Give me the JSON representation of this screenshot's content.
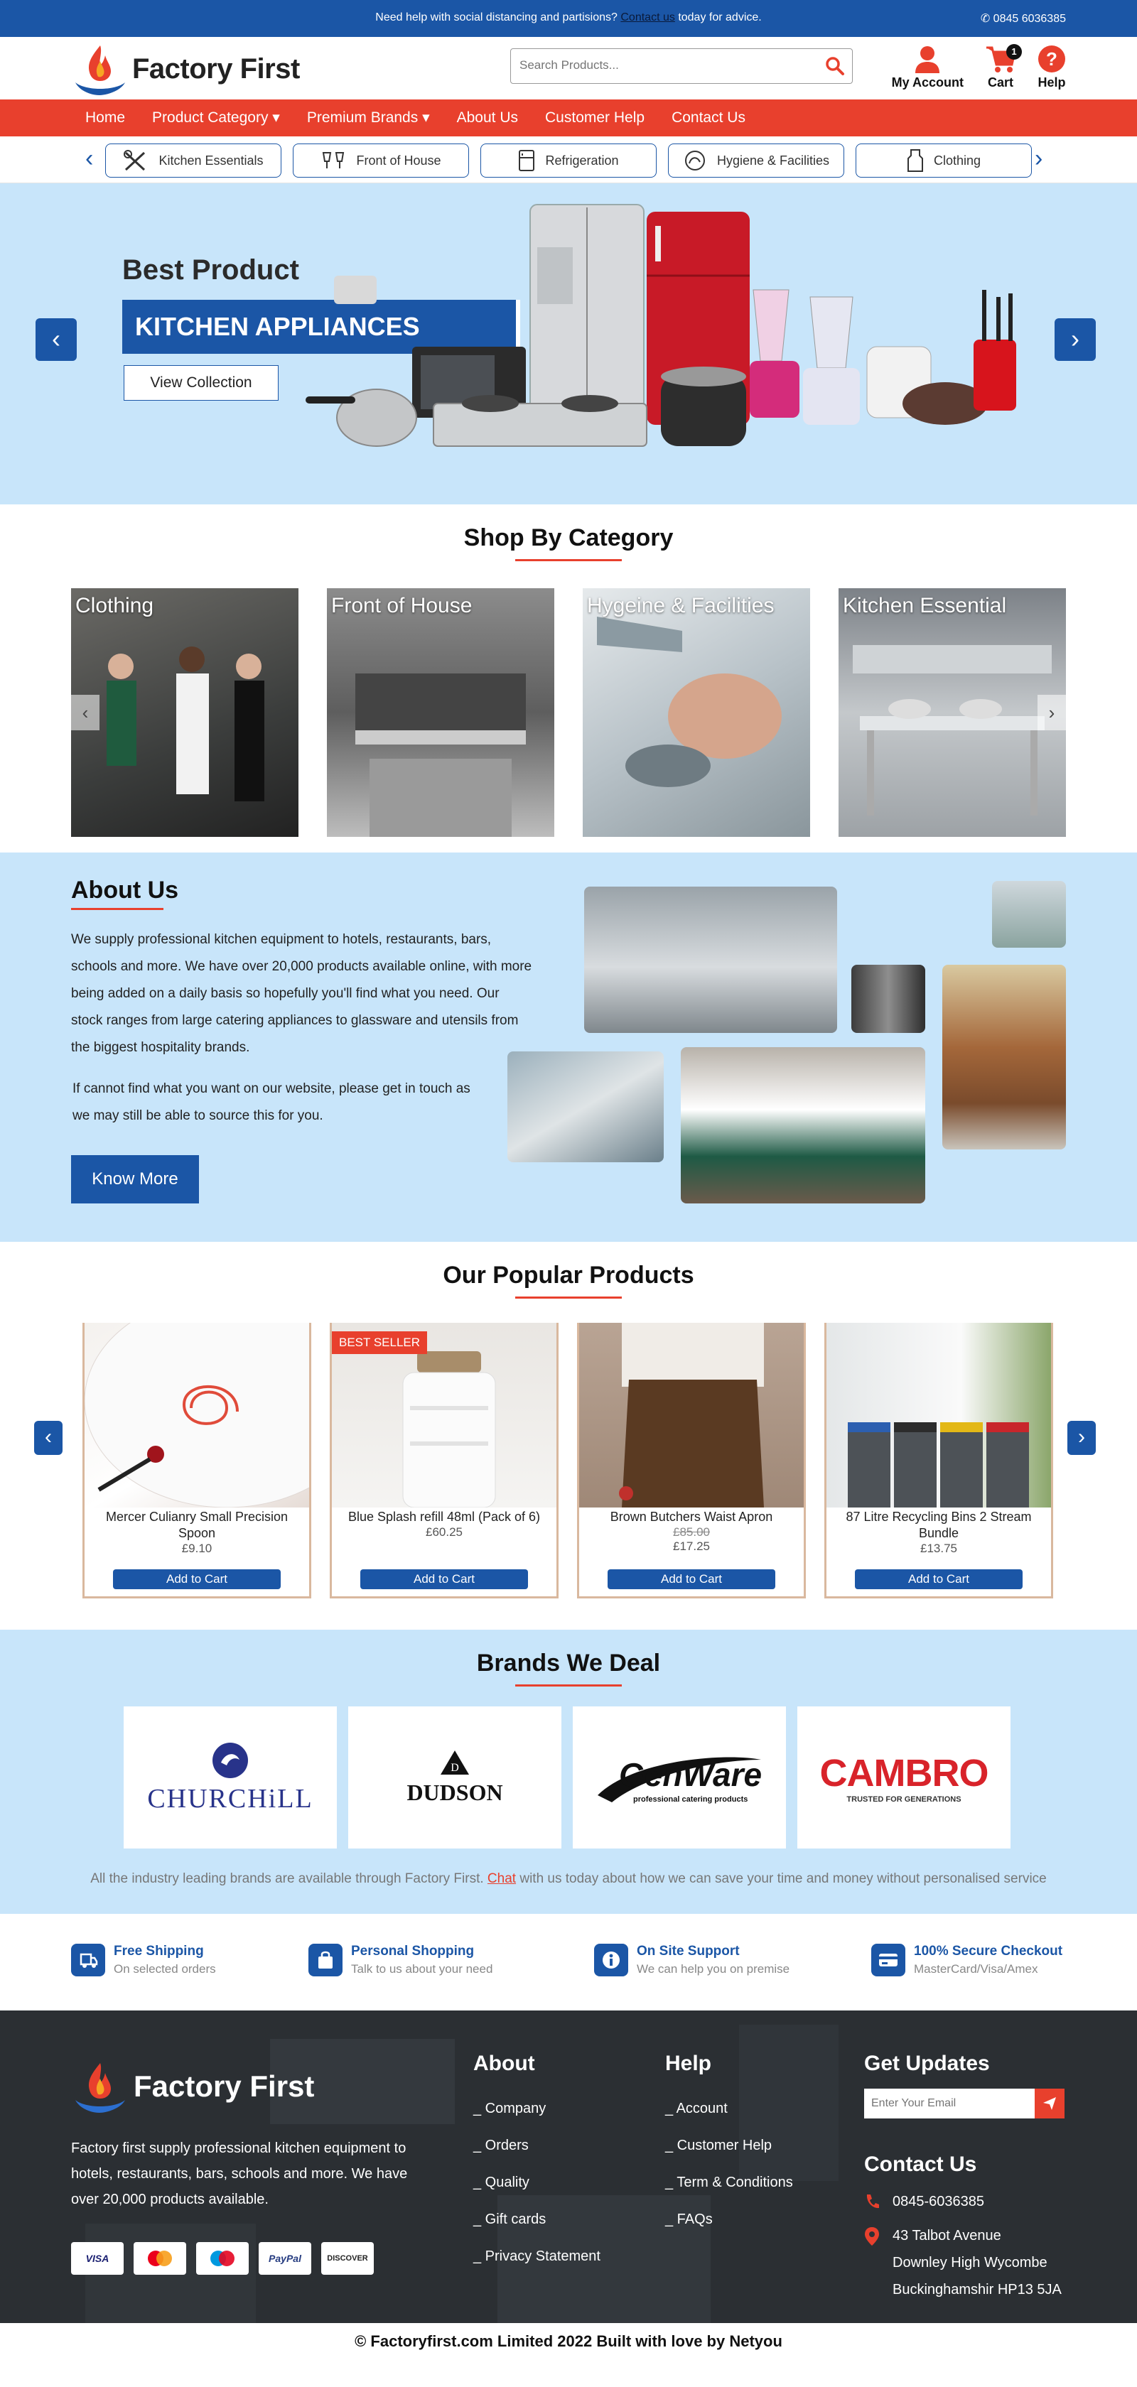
{
  "topbar": {
    "message_before": "Need help with social distancing and  partisions?",
    "message_link": "Contact us",
    "message_after": "today for advice.",
    "phone": "0845 6036385"
  },
  "header": {
    "logo_text": "Factory First",
    "search_placeholder": "Search Products...",
    "account_label": "My Account",
    "cart_label": "Cart",
    "cart_count": "1",
    "help_label": "Help"
  },
  "nav": {
    "items": [
      "Home",
      "Product Category",
      "Premium Brands",
      "About Us",
      "Customer Help",
      "Contact Us"
    ]
  },
  "category_pills": [
    "Kitchen Essentials",
    "Front of House",
    "Refrigeration",
    "Hygiene & Facilities",
    "Clothing"
  ],
  "hero": {
    "subtitle": "Best Product",
    "title": "KITCHEN APPLIANCES",
    "button": "View Collection"
  },
  "shop_by_category": {
    "title": "Shop By Category",
    "items": [
      "Clothing",
      "Front of House",
      "Hygeine & Facilities",
      "Kitchen Essential"
    ]
  },
  "about": {
    "title": "About Us",
    "p1": "We supply professional kitchen equipment to hotels, restaurants, bars, schools and more. We have over 20,000 products available online, with more being added on a daily basis so hopefully you'll find what you need. Our stock ranges from large catering appliances  to glassware and utensils from the biggest hospitality brands.",
    "p2": "If cannot find what you want on our website, please get in touch as we may still be able to source this for you.",
    "button": "Know More"
  },
  "popular": {
    "title": "Our Popular Products",
    "products": [
      {
        "name": "Mercer Culianry Small Precision Spoon",
        "price": "£9.10",
        "old_price": "",
        "badge": "",
        "cta": "Add to Cart"
      },
      {
        "name": "Blue Splash refill 48ml (Pack of 6)",
        "price": "£60.25",
        "old_price": "",
        "badge": "BEST SELLER",
        "cta": "Add to Cart"
      },
      {
        "name": "Brown Butchers Waist Apron",
        "price": "£17.25",
        "old_price": "£85.00",
        "badge": "",
        "cta": "Add to Cart"
      },
      {
        "name": "87 Litre Recycling Bins 2 Stream Bundle",
        "price": "£13.75",
        "old_price": "",
        "badge": "",
        "cta": "Add to Cart"
      }
    ]
  },
  "brands": {
    "title": "Brands We Deal",
    "items": [
      "CHURCHiLL",
      "DUDSON",
      "GenWare",
      "CAMBRO"
    ],
    "genware_tag": "professional catering products",
    "cambro_tag": "TRUSTED FOR GENERATIONS",
    "note_before": "All the industry leading brands are available through Factory First.",
    "note_link": "Chat",
    "note_after": "with us today about how we can save your time and money without personalised service"
  },
  "features": [
    {
      "title": "Free Shipping",
      "sub": "On selected orders",
      "icon": "shipping-icon"
    },
    {
      "title": "Personal Shopping",
      "sub": "Talk to us about your need",
      "icon": "shopping-bag-icon"
    },
    {
      "title": "On Site Support",
      "sub": "We can help you on premise",
      "icon": "info-icon"
    },
    {
      "title": "100% Secure Checkout",
      "sub": "MasterCard/Visa/Amex",
      "icon": "credit-card-icon"
    }
  ],
  "footer": {
    "logo_text": "Factory First",
    "description": "Factory first supply professional kitchen equipment to hotels, restaurants, bars, schools and more. We have over 20,000 products available.",
    "cards": [
      "VISA",
      "MC",
      "Maestro",
      "PayPal",
      "DISCOVER"
    ],
    "about_title": "About",
    "about_links": [
      "_ Company",
      "_ Orders",
      "_ Quality",
      "_ Gift cards",
      "_ Privacy Statement"
    ],
    "help_title": "Help",
    "help_links": [
      "_ Account",
      "_ Customer Help",
      "_ Term & Conditions",
      "_ FAQs"
    ],
    "updates_title": "Get Updates",
    "email_placeholder": "Enter Your Email",
    "contact_title": "Contact Us",
    "phone": "0845-6036385",
    "address": [
      "43 Talbot Avenue",
      "Downley High Wycombe",
      "Buckinghamshir HP13 5JA"
    ]
  },
  "copyright": "© Factoryfirst.com Limited 2022 Built with love by Netyou",
  "colors": {
    "brand_blue": "#1b56a6",
    "accent_red": "#e8402d",
    "light_blue_bg": "#c8e5fa"
  }
}
